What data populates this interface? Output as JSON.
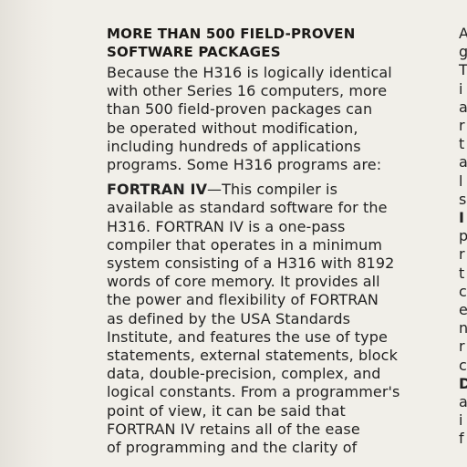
{
  "heading": {
    "line1": "MORE THAN 500 FIELD-PROVEN",
    "line2": "SOFTWARE PACKAGES"
  },
  "intro": {
    "lines": [
      "Because the H316 is logically identical",
      "with other Series 16 computers, more",
      "than 500 field-proven packages can",
      "be operated without modification,",
      "including hundreds of applications",
      "programs. Some H316 programs are:"
    ]
  },
  "fortran": {
    "term": "FORTRAN IV",
    "first_line_rest": "—This compiler is",
    "lines": [
      "available as standard software for the",
      "H316. FORTRAN IV is a one-pass",
      "compiler that operates in a minimum",
      "system consisting of a H316 with 8192",
      "words of core memory. It provides all",
      "the power and flexibility of FORTRAN",
      "as defined by the USA Standards",
      "Institute, and features the use of type",
      "statements, external statements, block",
      "data, double-precision, complex, and",
      "logical constants. From a programmer's",
      "point of view, it can be said that",
      "FORTRAN IV retains all of the ease",
      "of programming and the clarity of"
    ]
  },
  "right_column": {
    "letters": [
      "A",
      "g",
      "T",
      "i",
      "a",
      "r",
      "t",
      "a",
      "l",
      "s",
      "I",
      "p",
      "r",
      "t",
      "c",
      "e",
      "n",
      "r",
      "c",
      "D",
      "a",
      "i",
      "f"
    ]
  }
}
